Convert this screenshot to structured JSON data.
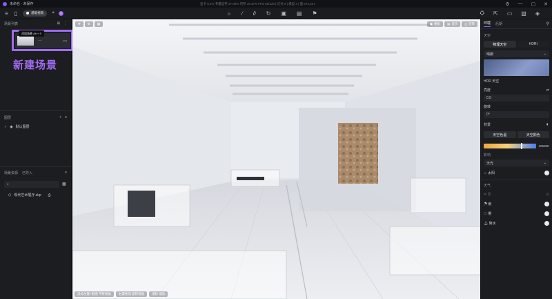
{
  "titlebar": {
    "title": "未命名 - 未保存",
    "stats": "显卡 5.4%   专属显存 27.05%   内存 16.37%   FPS 60/120   |   灯光 5   |   模型 3   |   面 672,317"
  },
  "toolbar": {
    "tool_chip_label": "基础视角",
    "left_icons": [
      "menu-icon",
      "document-icon",
      "cursor-icon",
      "logo-icon"
    ],
    "center_icons": [
      "light-icon",
      "brush-icon",
      "lasso-icon",
      "rotate-icon",
      "camera-icon",
      "image-icon",
      "flag-icon"
    ],
    "right_icons": [
      "render-icon",
      "export-icon",
      "video-icon",
      "image-save-icon",
      "cube-icon"
    ]
  },
  "scene_list": {
    "header": "场景列表",
    "tooltip": "添加场景 Alt + S",
    "scene_name": "新建场景"
  },
  "layers": {
    "header": "图层",
    "items": [
      "默认图层"
    ]
  },
  "assets": {
    "tab_scene": "场景资源",
    "tab_imported": "已导入",
    "files": [
      "现代艺术展厅.skp"
    ]
  },
  "viewport": {
    "top_right_buttons": [
      "相机",
      "显示",
      "渲染"
    ],
    "bottom_hints": [
      "鼠标左键+拖拽 平移视角",
      "右键拖拽 旋转视角",
      "滚轮 缩放"
    ]
  },
  "env_panel": {
    "tabs": [
      "环境",
      "后期"
    ],
    "sky_section": "天空",
    "sky_modes": [
      "物理天空",
      "HDRI"
    ],
    "preset": "晴朗",
    "hdr_label": "HDR 天空",
    "brightness_label": "亮度",
    "brightness_value": "0.5",
    "rotation_label": "旋转",
    "rotation_value": "0°",
    "bg_label": "背景",
    "sky_buttons": [
      "天空色温",
      "天空颜色"
    ],
    "temperature_value": "10500K",
    "shadow_label": "影响",
    "shadow_value": "天光",
    "sun_label": "太阳",
    "weather_section": "天气",
    "weather_items": [
      "雪",
      "雨",
      "雾",
      "降水"
    ]
  },
  "colors": {
    "accent": "#8b5cf6",
    "scene_highlight": "#a06cf0",
    "temp_gradient_start": "#f0a53a",
    "temp_gradient_end": "#4a7ef0"
  }
}
